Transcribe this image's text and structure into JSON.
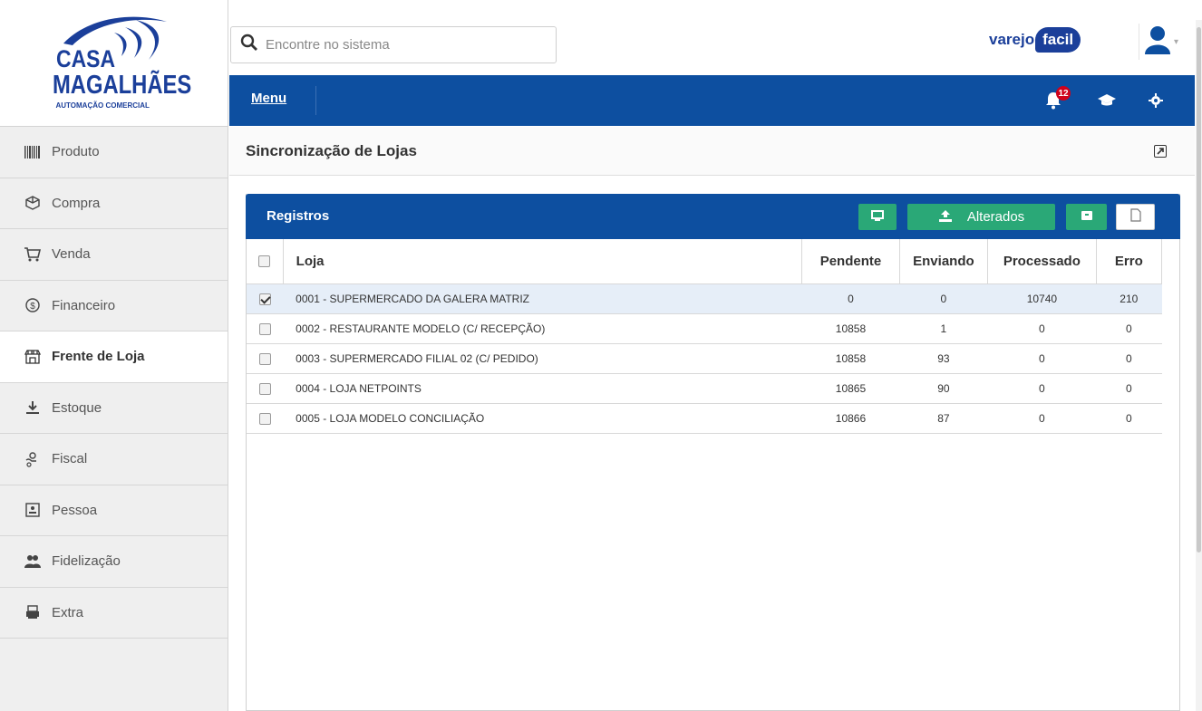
{
  "brand": {
    "logo_line1": "CASA",
    "logo_line2": "MAGALHÃES",
    "logo_line3": "AUTOMAÇÃO COMERCIAL",
    "product_part1": "varejo",
    "product_part2": "facil"
  },
  "search": {
    "placeholder": "Encontre no sistema",
    "value": ""
  },
  "menubar": {
    "menu_label": "Menu",
    "notification_count": "12"
  },
  "sidebar": {
    "items": [
      {
        "label": "Produto",
        "icon": "barcode-icon"
      },
      {
        "label": "Compra",
        "icon": "box-icon"
      },
      {
        "label": "Venda",
        "icon": "cart-icon"
      },
      {
        "label": "Financeiro",
        "icon": "dollar-icon"
      },
      {
        "label": "Frente de Loja",
        "icon": "store-icon",
        "active": true
      },
      {
        "label": "Estoque",
        "icon": "download-icon"
      },
      {
        "label": "Fiscal",
        "icon": "fiscal-icon"
      },
      {
        "label": "Pessoa",
        "icon": "contact-icon"
      },
      {
        "label": "Fidelização",
        "icon": "users-icon"
      },
      {
        "label": "Extra",
        "icon": "printer-icon"
      }
    ]
  },
  "page": {
    "title": "Sincronização de Lojas"
  },
  "panel": {
    "title": "Registros",
    "changed_button_label": "Alterados"
  },
  "table": {
    "headers": {
      "loja": "Loja",
      "pendente": "Pendente",
      "enviando": "Enviando",
      "processado": "Processado",
      "erro": "Erro"
    },
    "rows": [
      {
        "loja": "0001 - SUPERMERCADO DA GALERA MATRIZ",
        "pendente": "0",
        "enviando": "0",
        "processado": "10740",
        "erro": "210",
        "checked": true
      },
      {
        "loja": "0002 - RESTAURANTE MODELO (C/ RECEPÇÃO)",
        "pendente": "10858",
        "enviando": "1",
        "processado": "0",
        "erro": "0",
        "checked": false
      },
      {
        "loja": "0003 - SUPERMERCADO FILIAL 02 (C/ PEDIDO)",
        "pendente": "10858",
        "enviando": "93",
        "processado": "0",
        "erro": "0",
        "checked": false
      },
      {
        "loja": "0004 - LOJA NETPOINTS",
        "pendente": "10865",
        "enviando": "90",
        "processado": "0",
        "erro": "0",
        "checked": false
      },
      {
        "loja": "0005 - LOJA MODELO CONCILIAÇÃO",
        "pendente": "10866",
        "enviando": "87",
        "processado": "0",
        "erro": "0",
        "checked": false
      }
    ]
  },
  "colors": {
    "primary": "#0d4fa0",
    "success": "#2aa877",
    "brand": "#1b3f9a",
    "badge": "#d0021b"
  }
}
